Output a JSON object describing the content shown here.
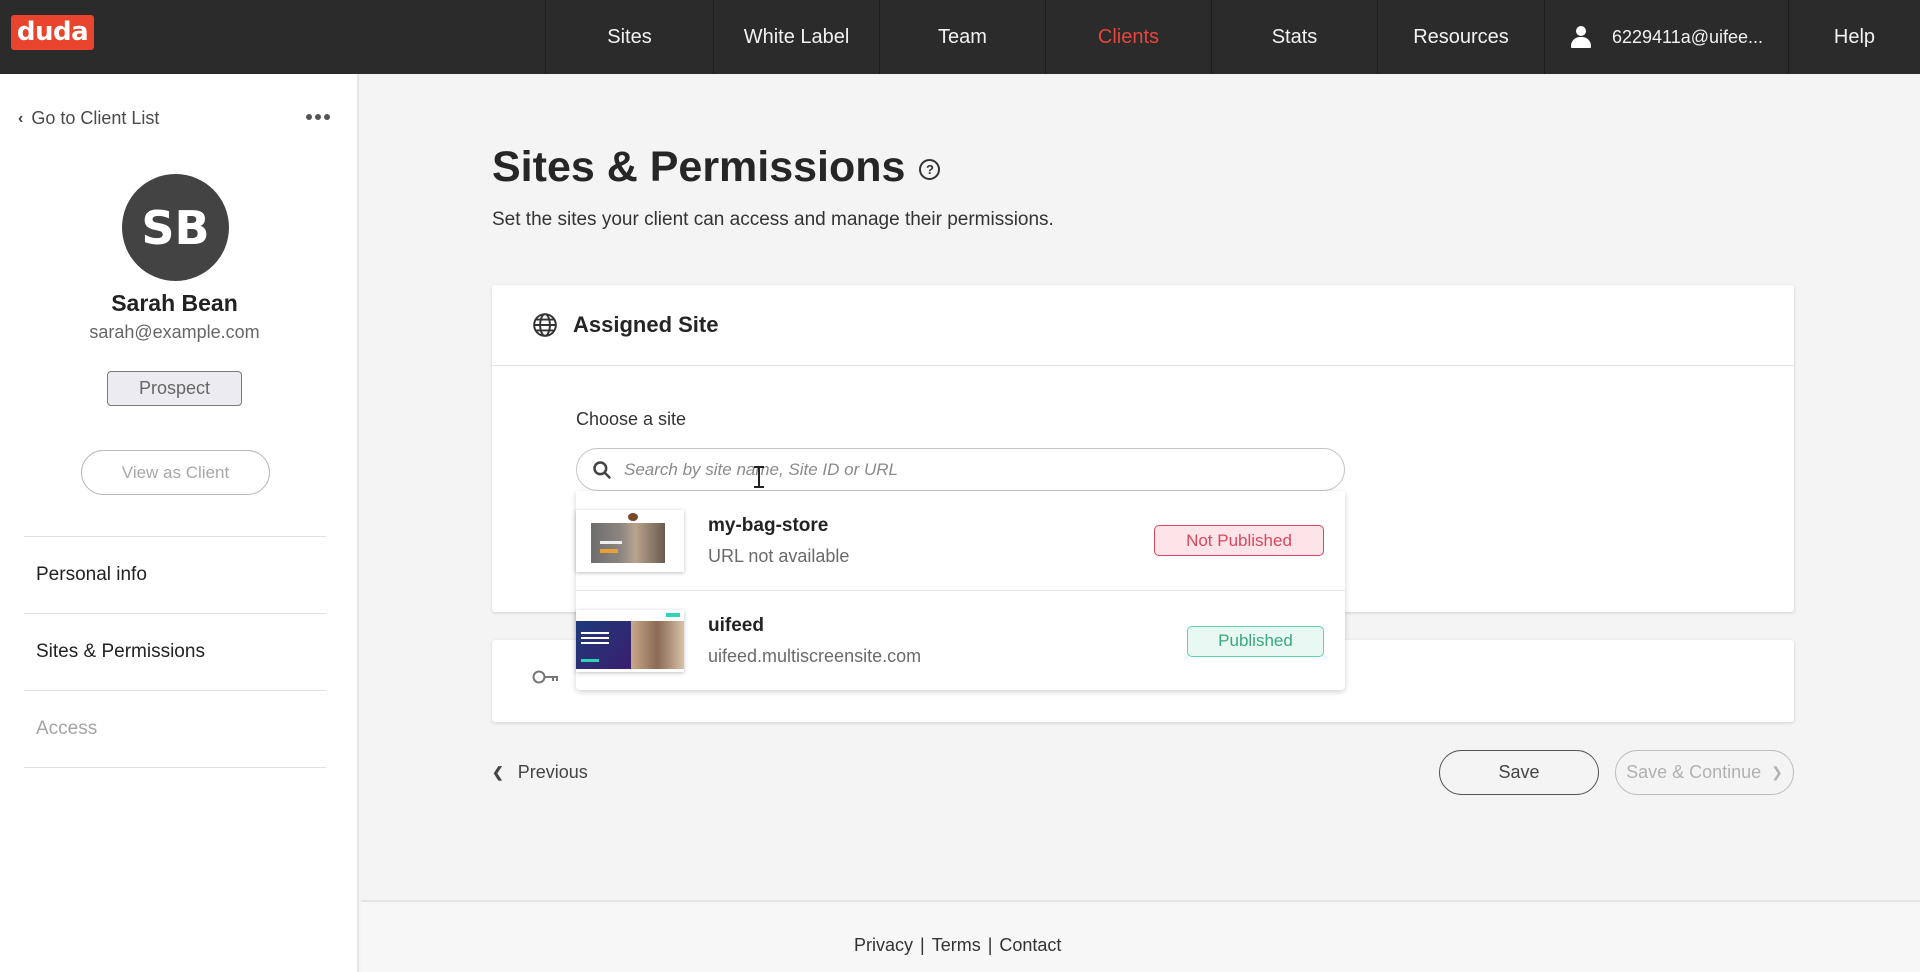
{
  "brand": {
    "logo_text": "duda",
    "accent": "#e8442e"
  },
  "nav": {
    "items": [
      {
        "label": "Sites"
      },
      {
        "label": "White Label"
      },
      {
        "label": "Team"
      },
      {
        "label": "Clients",
        "active": true
      },
      {
        "label": "Stats"
      },
      {
        "label": "Resources"
      },
      {
        "label": "6229411a@uifee...",
        "icon": "user-icon"
      },
      {
        "label": "Help"
      }
    ]
  },
  "sidebar": {
    "back_label": "Go to Client List",
    "avatar_initials": "SB",
    "client_name": "Sarah Bean",
    "client_email": "sarah@example.com",
    "status_tag": "Prospect",
    "view_as_client": "View as Client",
    "menu": [
      {
        "label": "Personal info",
        "enabled": true
      },
      {
        "label": "Sites & Permissions",
        "enabled": true
      },
      {
        "label": "Access",
        "enabled": false
      }
    ]
  },
  "main": {
    "title": "Sites & Permissions",
    "subtitle": "Set the sites your client can access and manage their permissions.",
    "assigned_card": {
      "title": "Assigned Site",
      "choose_label": "Choose a site",
      "search_placeholder": "Search by site name, Site ID or URL",
      "search_value": ""
    },
    "dropdown": {
      "sites": [
        {
          "name": "my-bag-store",
          "url": "URL not available",
          "status": "Not Published"
        },
        {
          "name": "uifeed",
          "url": "uifeed.multiscreensite.com",
          "status": "Published"
        }
      ]
    },
    "actions": {
      "previous": "Previous",
      "save": "Save",
      "save_continue": "Save & Continue"
    }
  },
  "footer": {
    "links": [
      "Privacy",
      "Terms",
      "Contact"
    ],
    "separator": "|"
  }
}
